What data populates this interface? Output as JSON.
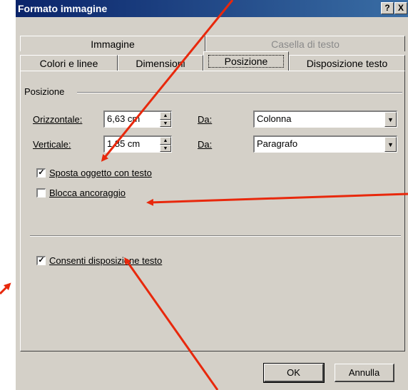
{
  "window": {
    "title": "Formato immagine",
    "help_btn": "?",
    "close_btn": "X"
  },
  "tabs_back": [
    {
      "label": "Immagine",
      "disabled": false
    },
    {
      "label": "Casella di testo",
      "disabled": true
    }
  ],
  "tabs_front": [
    {
      "label": "Colori e linee"
    },
    {
      "label": "Dimensioni"
    },
    {
      "label": "Posizione",
      "active": true
    },
    {
      "label": "Disposizione testo"
    }
  ],
  "position_group": {
    "label": "Posizione",
    "horizontal": {
      "label": "Orizzontale:",
      "value": "6,63 cm",
      "from_label": "Da:",
      "from_value": "Colonna"
    },
    "vertical": {
      "label": "Verticale:",
      "value": "1,85 cm",
      "from_label": "Da:",
      "from_value": "Paragrafo"
    }
  },
  "options": {
    "move_with_text": {
      "label": "Sposta oggetto con testo",
      "checked": true
    },
    "lock_anchor": {
      "label": "Blocca ancoraggio",
      "checked": false
    },
    "allow_wrap": {
      "label": "Consenti disposizione testo",
      "checked": true
    }
  },
  "buttons": {
    "ok": "OK",
    "cancel": "Annulla"
  },
  "colors": {
    "arrow": "#e8280c",
    "title_bar": "#0a246a",
    "dialog_bg": "#d4d0c8"
  }
}
